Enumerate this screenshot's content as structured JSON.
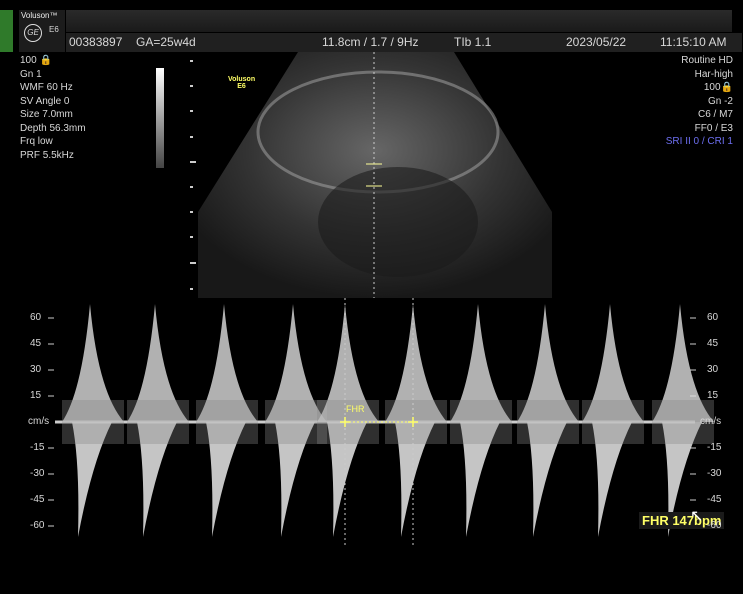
{
  "brand": {
    "name": "Voluson™",
    "model": "E6",
    "logo": "GE"
  },
  "header": {
    "patient_id": "00383897",
    "ga": "GA=25w4d",
    "depth_info": "11.8cm / 1.7 / 9Hz",
    "tib": "TIb  1.1",
    "date": "2023/05/22",
    "time": "11:15:10 AM"
  },
  "left_params": [
    "100 🔒",
    "Gn  1",
    "WMF 60 Hz",
    "SV Angle  0",
    "Size  7.0mm",
    "Depth 56.3mm",
    "Frq low",
    "PRF  5.5kHz"
  ],
  "right_params": [
    "Routine HD",
    "Har-high",
    "100🔒",
    "Gn  -2",
    "C6 / M7",
    "FF0 / E3"
  ],
  "right_params_highlight": "SRI II 0 / CRI 1",
  "image_watermark": {
    "line1": "Voluson",
    "line2": "E6"
  },
  "doppler": {
    "unit": "cm/s",
    "scale": [
      "60",
      "45",
      "30",
      "15",
      "-15",
      "-30",
      "-45",
      "-60"
    ],
    "caliper_label": "FHR",
    "fhr_result": "FHR 147bpm"
  }
}
